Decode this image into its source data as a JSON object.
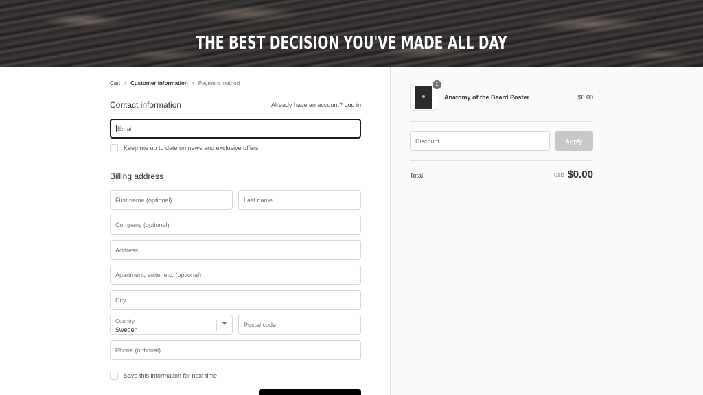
{
  "banner": {
    "title": "THE BEST DECISION YOU'VE MADE ALL DAY"
  },
  "breadcrumb": {
    "cart": "Cart",
    "customer_info": "Customer information",
    "payment": "Payment method"
  },
  "contact": {
    "title": "Contact information",
    "account_prompt": "Already have an account?",
    "login_link": "Log in",
    "email_placeholder": "Email",
    "newsletter_label": "Keep me up to date on news and exclusive offers"
  },
  "billing": {
    "title": "Billing address",
    "first_name": "First name (optional)",
    "last_name": "Last name",
    "company": "Company (optional)",
    "address": "Address",
    "apartment": "Apartment, suite, etc. (optional)",
    "city": "City",
    "country_label": "Country",
    "country_value": "Sweden",
    "postal": "Postal code",
    "phone": "Phone (optional)",
    "save_label": "Save this information for next time"
  },
  "order": {
    "product_name": "Anatomy of the Beard Poster",
    "quantity": "1",
    "product_price": "$0.00",
    "discount_placeholder": "Discount",
    "apply_label": "Apply",
    "total_label": "Total",
    "currency": "USD",
    "total_amount": "$0.00"
  },
  "colors": {
    "accent": "#000000",
    "sidebar_bg": "#fafafa",
    "apply_disabled": "#c8c8c8"
  }
}
